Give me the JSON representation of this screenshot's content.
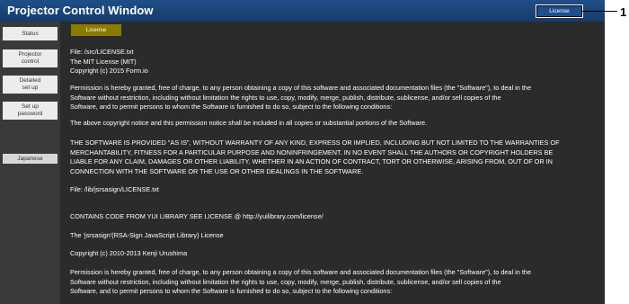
{
  "window": {
    "title": "Projector Control Window",
    "license_button": "License",
    "callout_number": "1"
  },
  "sidebar": {
    "items": [
      {
        "label": "Status"
      },
      {
        "label": "Projector\ncontrol"
      },
      {
        "label": "Detailed\nset up"
      },
      {
        "label": "Set up\npassword"
      },
      {
        "label": "Japanese"
      }
    ]
  },
  "content": {
    "active_tab": "License",
    "paragraphs": [
      "File: /src/LICENSE.txt\nThe MIT License (MIT)\nCopyright (c) 2015 Form.io",
      "Permission is hereby granted, free of charge, to any person obtaining a copy of this software and associated documentation files (the \"Software\"), to deal in the\nSoftware without restriction, including without limitation the rights to use, copy, modify, merge, publish, distribute, sublicense, and/or sell copies of the\nSoftware, and to permit persons to whom the Software is furnished to do so, subject to the following conditions:",
      "The above copyright notice and this permission notice shall be included in all copies or substantial portions of the Software.",
      "THE SOFTWARE IS PROVIDED \"AS IS\", WITHOUT WARRANTY OF ANY KIND, EXPRESS OR IMPLIED, INCLUDING BUT NOT LIMITED TO THE WARRANTIES OF\nMERCHANTABILITY, FITNESS FOR A PARTICULAR PURPOSE AND NONINFRINGEMENT. IN NO EVENT SHALL THE AUTHORS OR COPYRIGHT HOLDERS BE\nLIABLE FOR ANY CLAIM, DAMAGES OR OTHER LIABILITY, WHETHER IN AN ACTION OF CONTRACT, TORT OR OTHERWISE, ARISING FROM, OUT OF OR IN\nCONNECTION WITH THE SOFTWARE OR THE USE OR OTHER DEALINGS IN THE SOFTWARE.",
      "File: /lib/jsrsasign/LICENSE.txt",
      "CONTAINS CODE FROM YUI LIBRARY SEE LICENSE @ http://yuilibrary.com/license/",
      "The 'jsrsasign'(RSA-Sign JavaScript Library) License",
      "Copyright (c) 2010-2013 Kenji Urushima",
      "Permission is hereby granted, free of charge, to any person obtaining a copy of this software and associated documentation files (the \"Software\"), to deal in the\nSoftware without restriction, including without limitation the rights to use, copy, modify, merge, publish, distribute, sublicense, and/or sell copies of the\nSoftware, and to permit persons to whom the Software is furnished to do so, subject to the following conditions:"
    ]
  },
  "colors": {
    "titlebar": "#1f4e88",
    "panel_bg": "#2b2b2b",
    "active_tab": "#8a7a00"
  }
}
